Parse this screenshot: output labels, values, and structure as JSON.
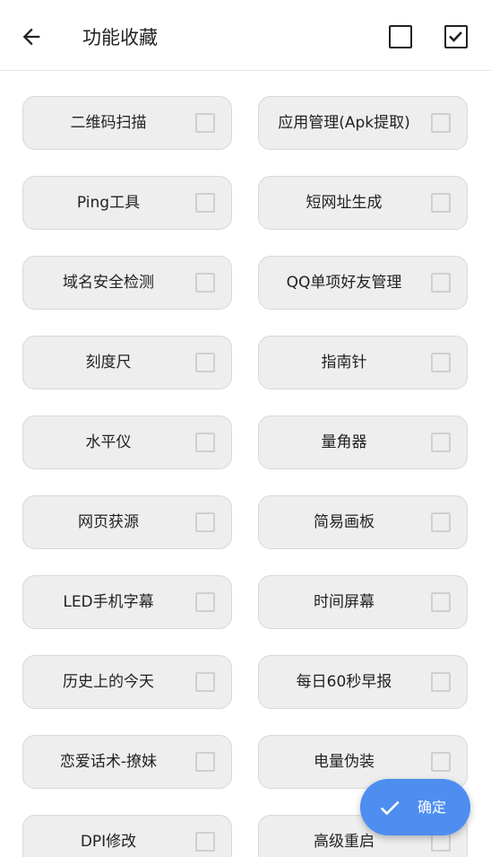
{
  "header": {
    "title": "功能收藏",
    "back_icon": "arrow-left-icon",
    "select_none_icon": "checkbox-empty-icon",
    "select_all_icon": "checkbox-checked-icon"
  },
  "features": [
    {
      "label": "二维码扫描",
      "checked": false
    },
    {
      "label": "应用管理(Apk提取)",
      "checked": false
    },
    {
      "label": "Ping工具",
      "checked": false
    },
    {
      "label": "短网址生成",
      "checked": false
    },
    {
      "label": "域名安全检测",
      "checked": false
    },
    {
      "label": "QQ单项好友管理",
      "checked": false
    },
    {
      "label": "刻度尺",
      "checked": false
    },
    {
      "label": "指南针",
      "checked": false
    },
    {
      "label": "水平仪",
      "checked": false
    },
    {
      "label": "量角器",
      "checked": false
    },
    {
      "label": "网页获源",
      "checked": false
    },
    {
      "label": "简易画板",
      "checked": false
    },
    {
      "label": "LED手机字幕",
      "checked": false
    },
    {
      "label": "时间屏幕",
      "checked": false
    },
    {
      "label": "历史上的今天",
      "checked": false
    },
    {
      "label": "每日60秒早报",
      "checked": false
    },
    {
      "label": "恋爱话术-撩妹",
      "checked": false
    },
    {
      "label": "电量伪装",
      "checked": false
    },
    {
      "label": "DPI修改",
      "checked": false
    },
    {
      "label": "高级重启",
      "checked": false
    }
  ],
  "fab": {
    "label": "确定",
    "icon": "check-icon"
  },
  "colors": {
    "accent": "#4d8ef0",
    "card_bg": "#eeeeee",
    "checkbox_border": "#cfcfcf"
  }
}
